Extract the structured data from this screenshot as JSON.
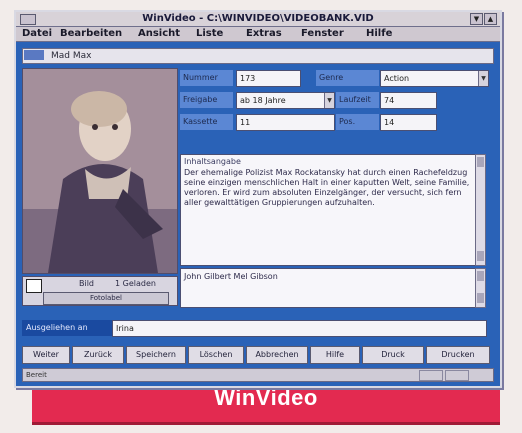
{
  "window": {
    "title": "WinVideo - C:\\WINVIDEO\\VIDEOBANK.VID"
  },
  "menu": [
    "Datei",
    "Bearbeiten",
    "Ansicht",
    "Liste",
    "Extras",
    "Fenster",
    "Hilfe"
  ],
  "toolbar_strip": {
    "text": "Mad Max"
  },
  "fields": [
    {
      "label": "Nummer",
      "value": "173"
    },
    {
      "label": "Genre",
      "value": "Action",
      "dropdown": true
    },
    {
      "label": "Freigabe",
      "value": "ab 18 Jahre",
      "dropdown": true
    },
    {
      "label": "Laufzeit",
      "value": "74"
    },
    {
      "label": "Kassette",
      "value": "11"
    },
    {
      "label": "Pos.",
      "value": "14"
    }
  ],
  "description": {
    "title": "Inhaltsangabe",
    "text": "Der ehemalige Polizist Max Rockatansky hat durch einen Rachefeldzug seine einzigen menschlichen Halt in einer kaputten Welt, seine Familie, verloren. Er wird zum absoluten Einzelgänger, der versucht, sich fern aller gewalttätigen Gruppierungen aufzuhalten."
  },
  "cast": {
    "text": "John Gilbert Mel Gibson"
  },
  "photo_controls": {
    "nav_label": "",
    "label_a": "Bild",
    "label_b": "1 Geladen",
    "button": "Fotolabel"
  },
  "loan": {
    "label": "Ausgeliehen an",
    "value": "Irina"
  },
  "buttons": [
    "Weiter",
    "Zurück",
    "Speichern",
    "Löschen",
    "Abbrechen",
    "Hilfe",
    "Druck",
    "Drucken"
  ],
  "status": {
    "text": "Bereit"
  },
  "caption": {
    "text": "WinVideo"
  }
}
